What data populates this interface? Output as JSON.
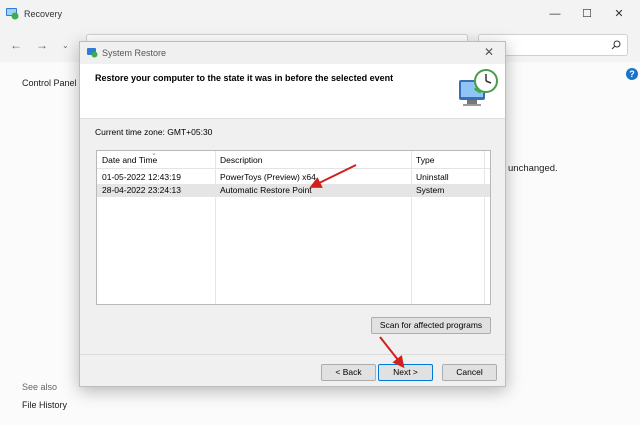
{
  "background_window": {
    "title": "Recovery",
    "nav_left_label": "Control Panel",
    "body_text_fragment": "unchanged.",
    "see_also_label": "See also",
    "see_also_link": "File History",
    "help_symbol": "?"
  },
  "dialog": {
    "title": "System Restore",
    "heading": "Restore your computer to the state it was in before the selected event",
    "timezone": "Current time zone: GMT+05:30",
    "columns": [
      "Date and Time",
      "Description",
      "Type"
    ],
    "rows": [
      {
        "date": "01-05-2022 12:43:19",
        "description": "PowerToys (Preview) x64",
        "type": "Uninstall",
        "selected": false
      },
      {
        "date": "28-04-2022 23:24:13",
        "description": "Automatic Restore Point",
        "type": "System",
        "selected": true
      }
    ],
    "scan_button": "Scan for affected programs",
    "back_button": "< Back",
    "next_button": "Next >",
    "cancel_button": "Cancel"
  },
  "colors": {
    "annotation_arrow": "#d0221c",
    "accent": "#0078d7",
    "selected_row": "#e5e5e5"
  },
  "icons": [
    "recovery-app-icon",
    "back-arrow-icon",
    "forward-arrow-icon",
    "dropdown-icon",
    "search-icon",
    "help-icon",
    "system-restore-icon",
    "restore-monitor-graphic-icon",
    "close-icon",
    "minimize-icon",
    "maximize-icon"
  ]
}
